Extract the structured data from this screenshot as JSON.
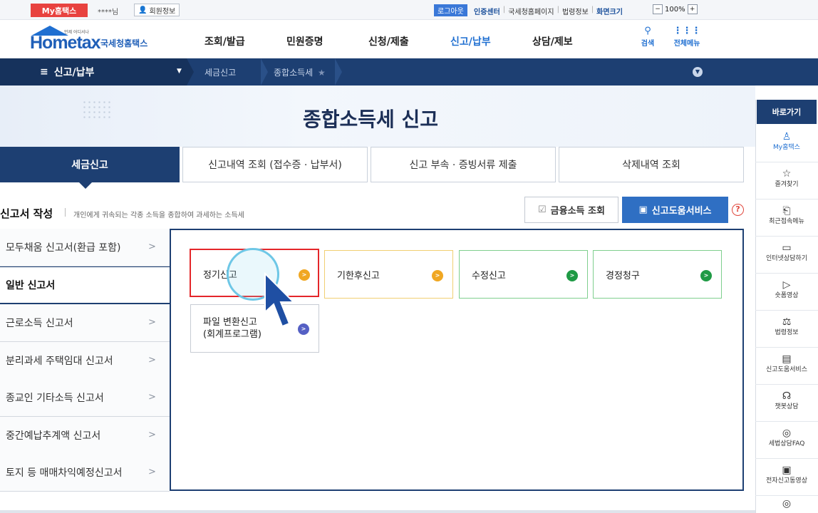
{
  "topbar": {
    "myhome": "My홈택스",
    "user": "****님",
    "member_info": "회원정보",
    "logout": "로그아웃",
    "links": [
      "인증센터",
      "국세청홈페이지",
      "법령정보",
      "화면크기"
    ],
    "zoom_minus": "−",
    "zoom_level": "100%",
    "zoom_plus": "+"
  },
  "header": {
    "logo_text": "Hometax",
    "logo_sub": "국세청홈택스",
    "tagline": "언제 어디서나",
    "nav": [
      "조회/발급",
      "민원증명",
      "신청/제출",
      "신고/납부",
      "상담/제보"
    ],
    "search_label": "검색",
    "allmenu_label": "전체메뉴"
  },
  "locbar": {
    "menu": "신고/납부",
    "crumbs": [
      "세금신고",
      "종합소득세"
    ]
  },
  "page": {
    "title": "종합소득세 신고"
  },
  "tabs": [
    "세금신고",
    "신고내역 조회 (접수증 · 납부서)",
    "신고 부속 · 증빙서류 제출",
    "삭제내역 조회"
  ],
  "section": {
    "title": "신고서 작성",
    "desc": "개인에게 귀속되는 각종 소득을 종합하여 과세하는 소득세",
    "btn_finance": "금융소득 조회",
    "btn_help": "신고도움서비스",
    "q": "?"
  },
  "side": [
    "모두채움 신고서(환급 포함)",
    "일반 신고서",
    "근로소득 신고서",
    "분리과세 주택임대 신고서",
    "종교인 기타소득 신고서",
    "중간예납추계액 신고서",
    "토지 등 매매차익예정신고서"
  ],
  "cards": [
    {
      "label": "정기신고",
      "color": "#f0a722"
    },
    {
      "label": "기한후신고",
      "color": "#f0a722"
    },
    {
      "label": "수정신고",
      "color": "#1f9a45"
    },
    {
      "label": "경정청구",
      "color": "#1f9a45"
    },
    {
      "label_line1": "파일 변환신고",
      "label_line2": "(회계프로그램)",
      "color": "#5560c4"
    }
  ],
  "quickbar": {
    "head": "바로가기",
    "items": [
      "My홈택스",
      "즐겨찾기",
      "최근접속메뉴",
      "인터넷상담하기",
      "숏폼영상",
      "법령정보",
      "신고도움서비스",
      "챗봇상담",
      "세법상담FAQ",
      "전자신고동영상"
    ]
  }
}
